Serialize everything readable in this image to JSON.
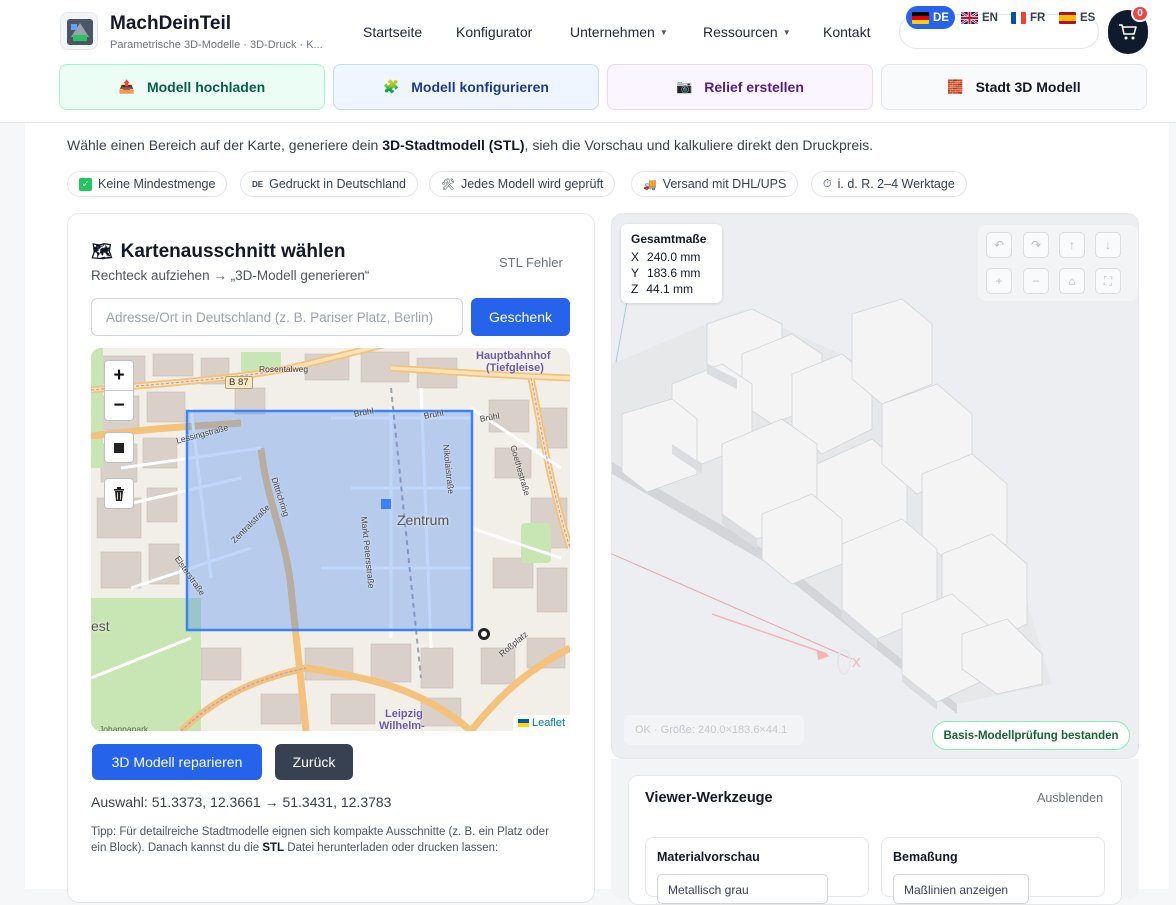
{
  "brand": {
    "name": "MachDeinTeil",
    "tagline": "Parametrische 3D-Modelle · 3D-Druck · K..."
  },
  "nav": [
    {
      "label": "Startseite",
      "dropdown": false
    },
    {
      "label": "Konfigurator",
      "dropdown": false
    },
    {
      "label": "Unternehmen",
      "dropdown": true
    },
    {
      "label": "Ressourcen",
      "dropdown": true
    },
    {
      "label": "Kontakt",
      "dropdown": false
    }
  ],
  "languages": [
    {
      "code": "DE",
      "active": true
    },
    {
      "code": "EN",
      "active": false
    },
    {
      "code": "FR",
      "active": false
    },
    {
      "code": "ES",
      "active": false
    }
  ],
  "cart": {
    "count": "0"
  },
  "feature_tabs": [
    {
      "label": "Modell hochladen",
      "icon": "upload-box-icon"
    },
    {
      "label": "Modell konfigurieren",
      "icon": "puzzle-icon"
    },
    {
      "label": "Relief erstellen",
      "icon": "camera-icon"
    },
    {
      "label": "Stadt 3D Modell",
      "icon": "brick-icon"
    }
  ],
  "intro": {
    "before": "Wähle einen Bereich auf der Karte, generiere dein ",
    "bold": "3D-Stadtmodell (STL)",
    "after": ", sieh die Vorschau und kalkuliere direkt den Druckpreis."
  },
  "chips": [
    {
      "label": "Keine Mindestmenge",
      "icon": "check-icon"
    },
    {
      "label": "Gedruckt in Deutschland",
      "icon": "de-icon"
    },
    {
      "label": "Jedes Modell wird geprüft",
      "icon": "tools-icon"
    },
    {
      "label": "Versand mit DHL/UPS",
      "icon": "truck-icon"
    },
    {
      "label": "i. d. R. 2–4 Werktage",
      "icon": "stopwatch-icon"
    }
  ],
  "left_card": {
    "title": "Kartenausschnitt wählen",
    "subtitle": "Rechteck aufziehen → „3D-Modell generieren“",
    "status": "STL Fehler",
    "search_placeholder": "Adresse/Ort in Deutschland (z. B. Pariser Platz, Berlin)",
    "search_value": "",
    "gift_button": "Geschenk",
    "repair_button": "3D Modell reparieren",
    "back_button": "Zurück",
    "selection": "Auswahl: 51.3373, 12.3661 → 51.3431, 12.3783",
    "tip_before": "Tipp: Für detailreiche Stadtmodelle eignen sich kompakte Ausschnitte (z. B. ein Platz oder ein Block). Danach kannst du die ",
    "tip_bold": "STL",
    "tip_after": " Datei herunterladen oder drucken lassen:"
  },
  "map": {
    "zoom_in": "+",
    "zoom_out": "−",
    "attribution": "Leaflet",
    "labels": [
      {
        "text": "Hauptbahnhof",
        "cls": "poi"
      },
      {
        "text": "(Tiefgleise)",
        "cls": "poi"
      },
      {
        "text": "Rosentalweg",
        "cls": "street"
      },
      {
        "text": "B 87",
        "cls": "shield"
      },
      {
        "text": "Brühl",
        "cls": "street"
      },
      {
        "text": "Brühl",
        "cls": "street"
      },
      {
        "text": "Brühl",
        "cls": "street"
      },
      {
        "text": "Lessingstraße",
        "cls": "street"
      },
      {
        "text": "Dittrichring",
        "cls": "street"
      },
      {
        "text": "Zentrum",
        "cls": "district"
      },
      {
        "text": "Nikolaistraße",
        "cls": "street"
      },
      {
        "text": "Goethestraße",
        "cls": "street"
      },
      {
        "text": "Markt Petersstraße",
        "cls": "street"
      },
      {
        "text": "Zentralstraße",
        "cls": "street"
      },
      {
        "text": "Elsterstraße",
        "cls": "street"
      },
      {
        "text": "Roßplatz",
        "cls": "street"
      },
      {
        "text": "est",
        "cls": "district"
      },
      {
        "text": "Leipzig",
        "cls": "poi"
      },
      {
        "text": "Wilhelm-",
        "cls": "poi"
      },
      {
        "text": "Johannapark",
        "cls": "park"
      }
    ]
  },
  "viewer": {
    "dims_title": "Gesamtmaße",
    "dims": [
      {
        "axis": "X",
        "value": "240.0 mm"
      },
      {
        "axis": "Y",
        "value": "183.6 mm"
      },
      {
        "axis": "Z",
        "value": "44.1 mm"
      }
    ],
    "buttons": [
      {
        "name": "undo-button",
        "glyph": "↶"
      },
      {
        "name": "redo-button",
        "glyph": "↷"
      },
      {
        "name": "move-up-button",
        "glyph": "↑"
      },
      {
        "name": "move-down-button",
        "glyph": "↓"
      },
      {
        "name": "zoom-in-button",
        "glyph": "+"
      },
      {
        "name": "zoom-out-button",
        "glyph": "−"
      },
      {
        "name": "home-button",
        "glyph": "⌂"
      },
      {
        "name": "fullscreen-button",
        "glyph": "⛶"
      }
    ],
    "status": "OK · Größe: 240.0×183.6×44.1",
    "check": "Basis-Modellprüfung bestanden",
    "axis_x_label": "X"
  },
  "tools": {
    "title": "Viewer-Werkzeuge",
    "hide": "Ausblenden",
    "material_title": "Materialvorschau",
    "material_value": "Metallisch grau",
    "dims_title": "Bemaßung",
    "dims_value": "Maßlinien anzeigen"
  },
  "colors": {
    "accent": "#2563eb",
    "success": "#16a34a",
    "danger": "#ef4444",
    "navy": "#0f1a2c"
  }
}
